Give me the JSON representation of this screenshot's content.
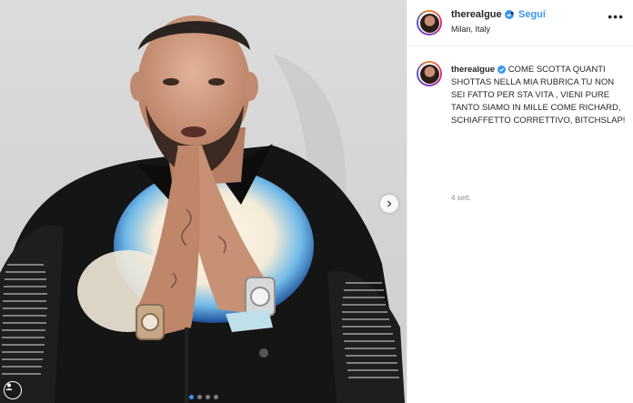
{
  "post": {
    "author": {
      "username": "therealgue",
      "verified": true,
      "location": "Milan, Italy"
    },
    "header": {
      "separator": "•",
      "follow_label": "Segui",
      "more_label": "•••"
    },
    "caption": {
      "username": "therealgue",
      "text": "COME SCOTTA QUANTI SHOTTAS NELLA MIA RUBRICA TU NON SEI FATTO PER STA VITA , VIENI PURE TANTO SIAMO IN MILLE COME RICHARD, SCHIAFFETTO CORRETTIVO, BITCHSLAP!",
      "time": "4 sett."
    },
    "media": {
      "carousel_count": 4,
      "carousel_active_index": 0
    },
    "colors": {
      "link": "#3897f0",
      "text": "#262626",
      "muted": "#8e8e8e",
      "border": "#efefef"
    },
    "icons": [
      "verified-badge-icon",
      "more-options-icon",
      "next-arrow-icon",
      "carousel-dot-icon"
    ]
  }
}
